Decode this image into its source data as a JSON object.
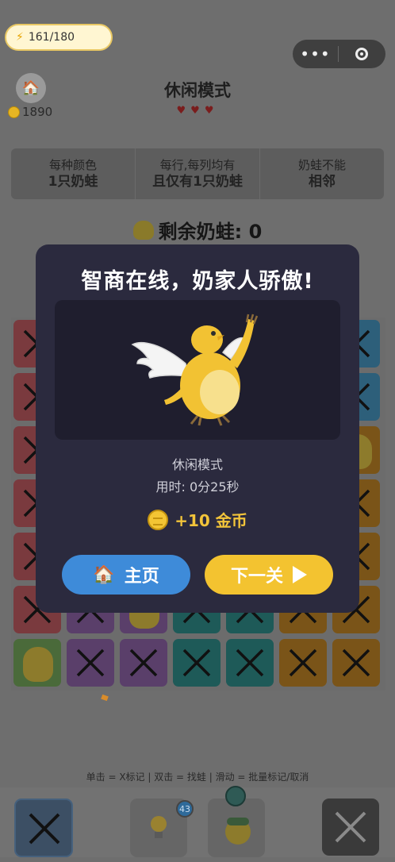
{
  "header": {
    "energy": "161/180",
    "coins": "1890",
    "title": "休闲模式",
    "hearts": "♥♥♥"
  },
  "rules": [
    {
      "line1": "每种颜色",
      "line2": "1只奶蛙"
    },
    {
      "line1": "每行,每列均有",
      "line2": "且仅有1只奶蛙"
    },
    {
      "line1": "奶蛙不能",
      "line2": "相邻"
    }
  ],
  "remaining": "剩余奶蛙: 0",
  "hint": "单击 = X标记 | 双击 = 找蛙 | 滑动 = 批量标记/取消",
  "hint_count": "43",
  "modal": {
    "title": "智商在线，奶家人骄傲!",
    "mode": "休闲模式",
    "time": "用时:  0分25秒",
    "reward": "+10  金币",
    "home_label": "主页",
    "next_label": "下一关"
  },
  "colors": {
    "modal_bg": "#2b2a3e",
    "home_button": "#3e8bd9",
    "next_button": "#f3c330",
    "reward_text": "#f2c43a"
  },
  "icons": [
    "lightning-icon",
    "more-dots-icon",
    "target-ring-icon",
    "house-icon",
    "coin-icon",
    "heart-icon",
    "lightbulb-icon",
    "video-icon",
    "play-icon",
    "x-mark-icon"
  ]
}
